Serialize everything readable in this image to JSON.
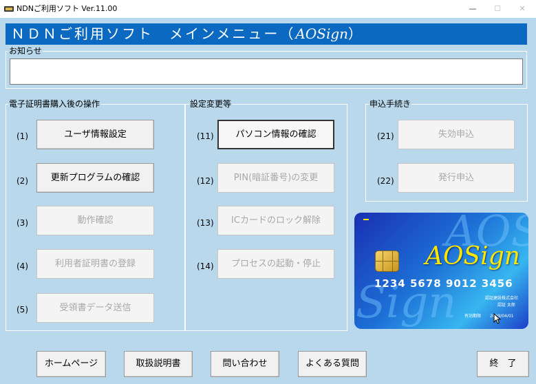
{
  "window": {
    "title": "NDNご利用ソフト Ver.11.00",
    "minimize": "—",
    "maximize": "☐",
    "close": "✕"
  },
  "header": {
    "title_main": "ＮＤＮご利用ソフト　メインメニュー（",
    "title_brand": "AOSign",
    "title_end": "）"
  },
  "notice": {
    "label": "お知らせ",
    "text": ""
  },
  "groups": {
    "after_purchase": {
      "label": "電子証明書購入後の操作",
      "items": [
        {
          "num": "(1)",
          "label": "ユーザ情報設定",
          "state": "active"
        },
        {
          "num": "(2)",
          "label": "更新プログラムの確認",
          "state": "active"
        },
        {
          "num": "(3)",
          "label": "動作確認",
          "state": "disabled"
        },
        {
          "num": "(4)",
          "label": "利用者証明書の登録",
          "state": "disabled"
        },
        {
          "num": "(5)",
          "label": "受領書データ送信",
          "state": "disabled"
        }
      ]
    },
    "settings": {
      "label": "設定変更等",
      "items": [
        {
          "num": "(11)",
          "label": "パソコン情報の確認",
          "state": "focused"
        },
        {
          "num": "(12)",
          "label": "PIN(暗証番号)の変更",
          "state": "disabled"
        },
        {
          "num": "(13)",
          "label": "ICカードのロック解除",
          "state": "disabled"
        },
        {
          "num": "(14)",
          "label": "プロセスの起動・停止",
          "state": "disabled"
        }
      ]
    },
    "application": {
      "label": "申込手続き",
      "items": [
        {
          "num": "(21)",
          "label": "失効申込",
          "state": "disabled"
        },
        {
          "num": "(22)",
          "label": "発行申込",
          "state": "disabled"
        }
      ]
    }
  },
  "card": {
    "brand": "AOSign",
    "number": "1234  5678  9012  3456",
    "company": "認証建設株式会社",
    "name": "認証  太郎",
    "expiry_label": "有効期限",
    "expiry": "2099/04/01",
    "bg_text_1": "AOS",
    "bg_text_2": "Sign"
  },
  "footer": {
    "homepage": "ホームページ",
    "manual": "取扱説明書",
    "contact": "問い合わせ",
    "faq": "よくある質問",
    "exit": "終　了"
  },
  "colors": {
    "background": "#b9d8ec",
    "header": "#0b69c1",
    "card_brand": "#ffe600"
  }
}
